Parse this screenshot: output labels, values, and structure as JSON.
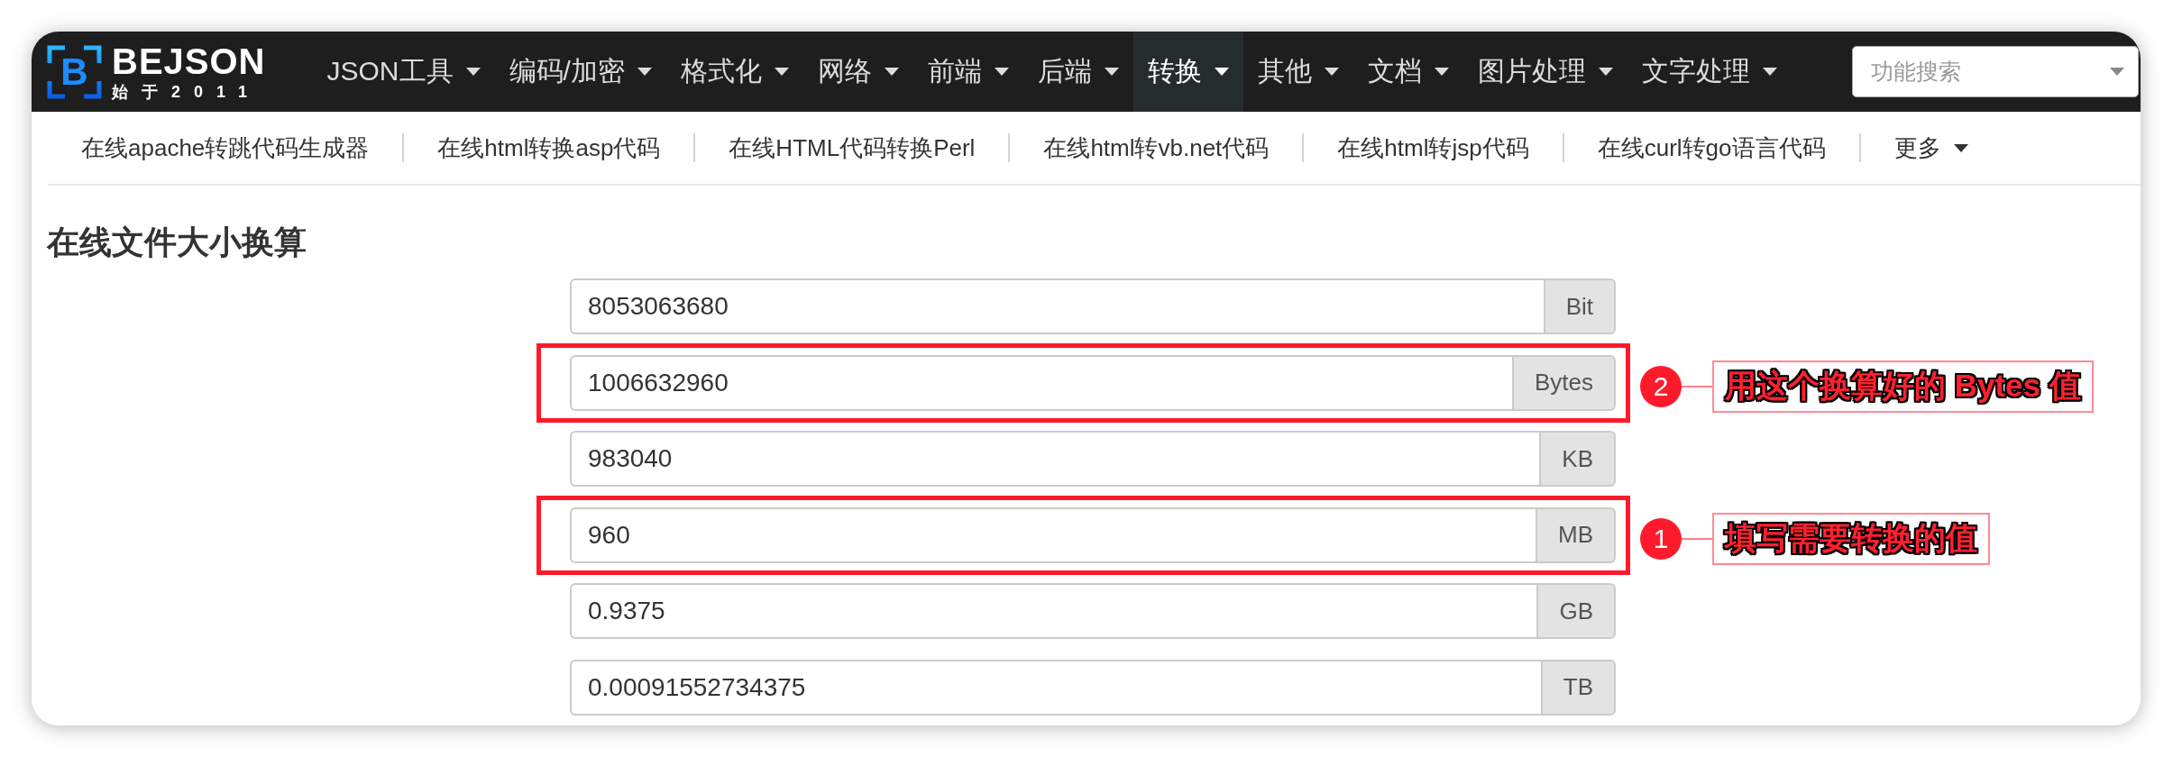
{
  "logo": {
    "mark": "B",
    "name": "BEJSON",
    "tagline": "始于2011"
  },
  "navbar": {
    "items": [
      {
        "label": "JSON工具",
        "selected": false
      },
      {
        "label": "编码/加密",
        "selected": false
      },
      {
        "label": "格式化",
        "selected": false
      },
      {
        "label": "网络",
        "selected": false
      },
      {
        "label": "前端",
        "selected": false
      },
      {
        "label": "后端",
        "selected": false
      },
      {
        "label": "转换",
        "selected": true
      },
      {
        "label": "其他",
        "selected": false
      },
      {
        "label": "文档",
        "selected": false
      },
      {
        "label": "图片处理",
        "selected": false
      },
      {
        "label": "文字处理",
        "selected": false
      }
    ],
    "search": {
      "placeholder": "功能搜索"
    }
  },
  "subnav": [
    {
      "label": "在线apache转跳代码生成器",
      "kind": "link"
    },
    {
      "label": "在线html转换asp代码",
      "kind": "link"
    },
    {
      "label": "在线HTML代码转换Perl",
      "kind": "link"
    },
    {
      "label": "在线html转vb.net代码",
      "kind": "link"
    },
    {
      "label": "在线html转jsp代码",
      "kind": "link"
    },
    {
      "label": "在线curl转go语言代码",
      "kind": "link"
    },
    {
      "label": "更多",
      "kind": "menu"
    }
  ],
  "page_title": "在线文件大小换算",
  "converter": {
    "rows": [
      {
        "value": "8053063680",
        "unit": "Bit"
      },
      {
        "value": "1006632960",
        "unit": "Bytes",
        "annotation": {
          "number": "2",
          "text": "用这个换算好的 Bytes 值"
        }
      },
      {
        "value": "983040",
        "unit": "KB"
      },
      {
        "value": "960",
        "unit": "MB",
        "annotation": {
          "number": "1",
          "text": "填写需要转换的值"
        }
      },
      {
        "value": "0.9375",
        "unit": "GB"
      },
      {
        "value": "0.00091552734375",
        "unit": "TB"
      }
    ]
  }
}
